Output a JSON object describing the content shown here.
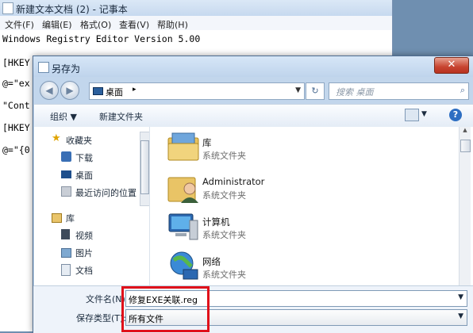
{
  "notepad": {
    "title": "新建文本文档 (2) - 记事本",
    "menu": [
      "文件(F)",
      "编辑(E)",
      "格式(O)",
      "查看(V)",
      "帮助(H)"
    ],
    "lines": [
      "Windows Registry Editor Version 5.00",
      "[HKEY",
      "@=\"ex",
      "\"Cont",
      "[HKEY",
      "@=\"{0"
    ]
  },
  "dialog": {
    "title": "另存为",
    "close": "✕",
    "address": {
      "location": "桌面",
      "separator": "▸"
    },
    "search_placeholder": "搜索 桌面",
    "toolbar": {
      "organize": "组织 ▼",
      "new_folder": "新建文件夹"
    },
    "nav": {
      "favorites": "收藏夹",
      "items": [
        "下载",
        "桌面",
        "最近访问的位置"
      ],
      "library": "库",
      "lib_items": [
        "视频",
        "图片",
        "文档"
      ]
    },
    "files": [
      {
        "name": "库",
        "sub": "系统文件夹"
      },
      {
        "name": "Administrator",
        "sub": "系统文件夹"
      },
      {
        "name": "计算机",
        "sub": "系统文件夹"
      },
      {
        "name": "网络",
        "sub": "系统文件夹"
      }
    ],
    "filename_label": "文件名(N):",
    "filename_value": "修复EXE关联.reg",
    "filetype_label": "保存类型(T):",
    "filetype_value": "所有文件"
  },
  "colors": {
    "highlight": "#e0101a",
    "accent": "#2d6ec2"
  }
}
